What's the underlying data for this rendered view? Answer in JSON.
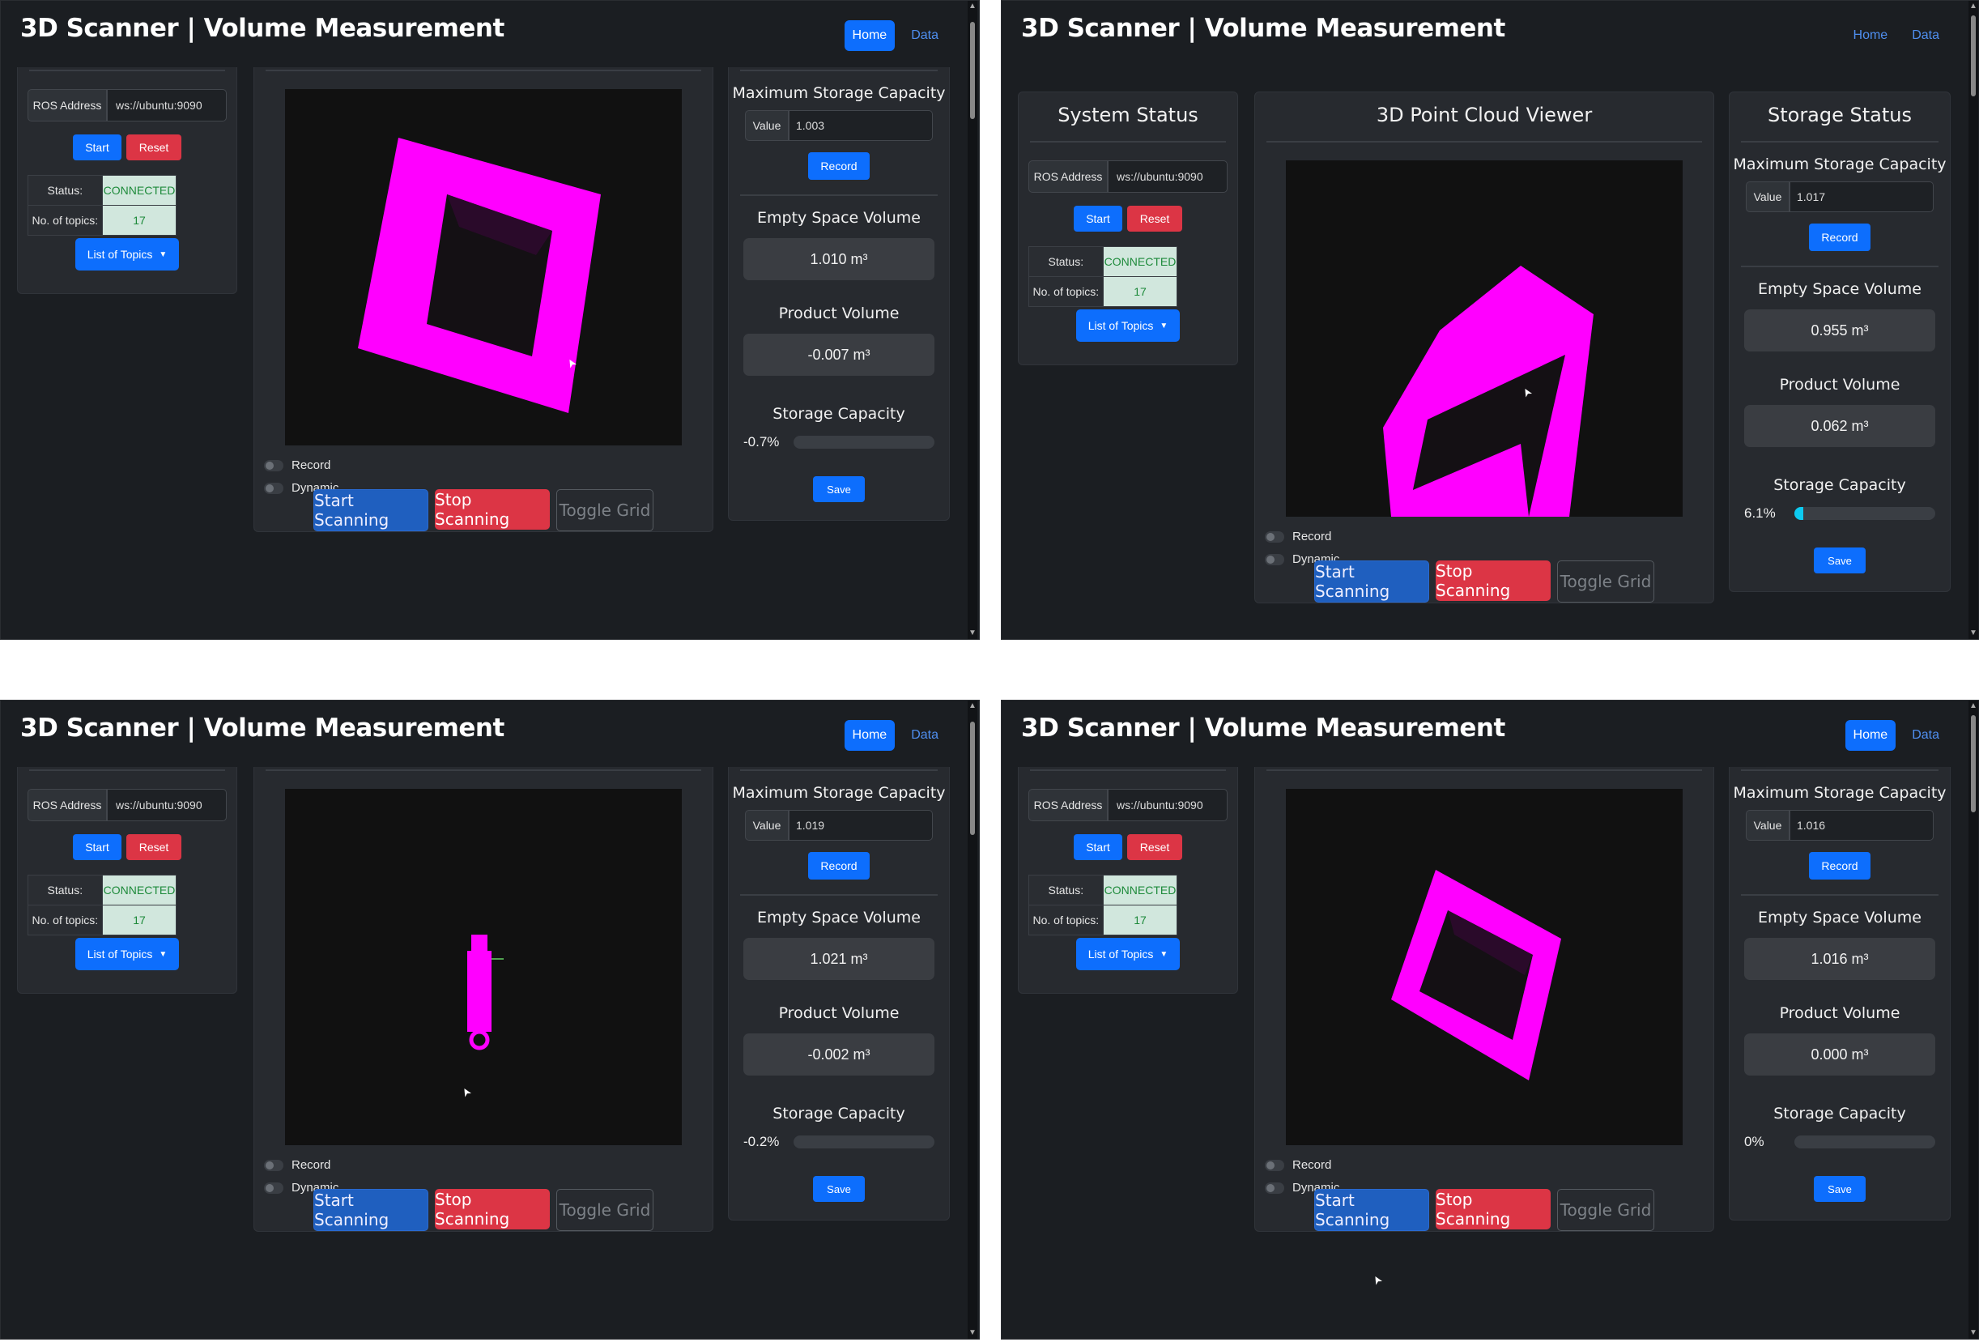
{
  "app_title": "3D Scanner | Volume Measurement",
  "nav": {
    "home": "Home",
    "data": "Data"
  },
  "system_status": {
    "title": "System Status",
    "ros_label": "ROS Address",
    "ros_value": "ws://ubuntu:9090",
    "start_label": "Start",
    "reset_label": "Reset",
    "status_key": "Status:",
    "status_value": "CONNECTED",
    "topics_key": "No. of topics:",
    "topics_value": "17",
    "topics_button": "List of Topics"
  },
  "viewer": {
    "title": "3D Point Cloud Viewer",
    "record_label": "Record",
    "dynamic_label": "Dynamic",
    "start_scan": "Start Scanning",
    "stop_scan": "Stop Scanning",
    "toggle_grid": "Toggle Grid"
  },
  "storage": {
    "title": "Storage Status",
    "max_title": "Maximum Storage Capacity",
    "value_label": "Value",
    "record_button": "Record",
    "empty_title": "Empty Space Volume",
    "product_title": "Product Volume",
    "capacity_title": "Storage Capacity",
    "save_button": "Save"
  },
  "screenshots": [
    {
      "max_value": "1.003",
      "empty_volume": "1.010 m³",
      "product_volume": "-0.007 m³",
      "capacity_text": "-0.7%",
      "capacity_fraction": 0,
      "cloud_shape": "box-tilted"
    },
    {
      "max_value": "1.017",
      "empty_volume": "0.955 m³",
      "product_volume": "0.062 m³",
      "capacity_text": "6.1%",
      "capacity_fraction": 0.061,
      "cloud_shape": "box-side"
    },
    {
      "max_value": "1.019",
      "empty_volume": "1.021 m³",
      "product_volume": "-0.002 m³",
      "capacity_text": "-0.2%",
      "capacity_fraction": 0,
      "cloud_shape": "small-object"
    },
    {
      "max_value": "1.016",
      "empty_volume": "1.016 m³",
      "product_volume": "0.000 m³",
      "capacity_text": "0%",
      "capacity_fraction": 0,
      "cloud_shape": "box-diamond"
    }
  ],
  "colors": {
    "point_cloud": "#ff00ff",
    "primary": "#0d6efd",
    "danger": "#dc3545",
    "success_bg": "#d1e7dd"
  }
}
